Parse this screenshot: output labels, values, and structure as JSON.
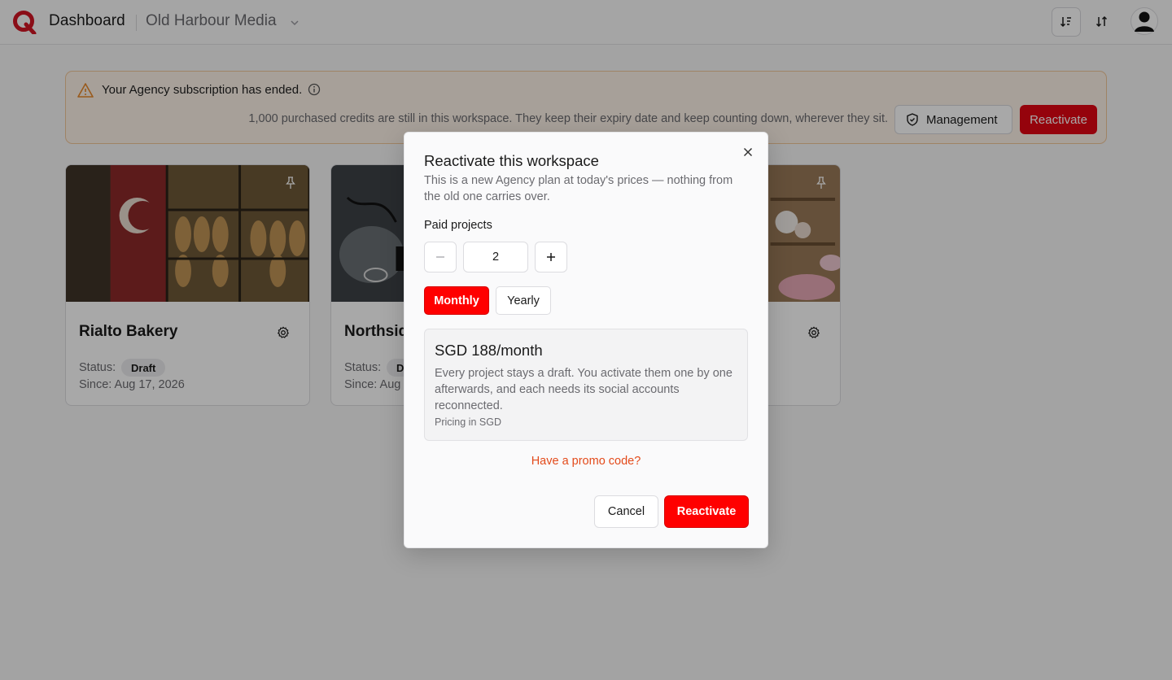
{
  "header": {
    "app_title": "Dashboard",
    "workspace_name": "Old Harbour Media"
  },
  "banner": {
    "title": "Your Agency subscription has ended.",
    "message": "1,000 purchased credits are still in this workspace. They keep their expiry date and keep counting down, wherever they sit.",
    "management_label": "Management",
    "reactivate_label": "Reactivate"
  },
  "projects": [
    {
      "name": "Rialto Bakery",
      "status_label": "Status:",
      "status": "Draft",
      "since": "Since: Aug 17, 2026"
    },
    {
      "name": "Northsid",
      "status_label": "Status:",
      "status": "D",
      "since": "Since: Aug 1"
    },
    {
      "name": "",
      "status_label": "",
      "status": "",
      "since": ""
    }
  ],
  "modal": {
    "title": "Reactivate this workspace",
    "description": "This is a new Agency plan at today's prices — nothing from the old one carries over.",
    "paid_projects_label": "Paid projects",
    "quantity": "2",
    "billing_monthly": "Monthly",
    "billing_yearly": "Yearly",
    "price": "SGD 188/month",
    "price_description": "Every project stays a draft. You activate them one by one afterwards, and each needs its social accounts reconnected.",
    "currency_note": "Pricing in SGD",
    "promo_link": "Have a promo code?",
    "cancel_label": "Cancel",
    "confirm_label": "Reactivate"
  },
  "colors": {
    "brand_red": "#e30613",
    "primary_red": "#ff0000",
    "warning_orange": "#e8892b",
    "promo_link": "#e34a1a"
  }
}
